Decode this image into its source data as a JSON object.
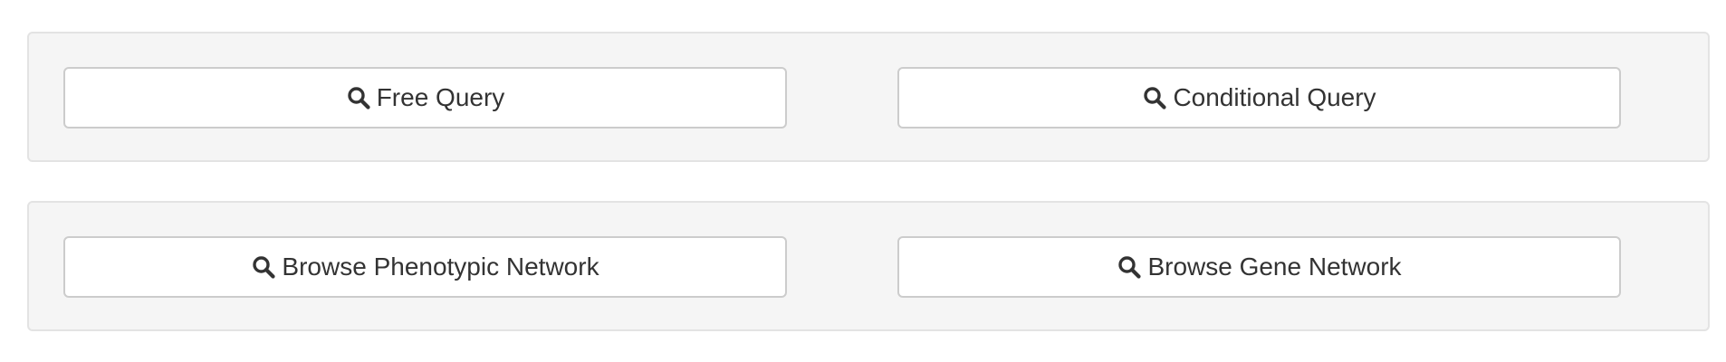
{
  "panels": [
    {
      "buttons": [
        {
          "label": "Free Query",
          "icon": "search-icon"
        },
        {
          "label": "Conditional Query",
          "icon": "search-icon"
        }
      ]
    },
    {
      "buttons": [
        {
          "label": "Browse Phenotypic Network",
          "icon": "search-icon"
        },
        {
          "label": "Browse Gene Network",
          "icon": "search-icon"
        }
      ]
    }
  ],
  "colors": {
    "panel_background": "#f5f5f5",
    "panel_border": "#e3e3e3",
    "button_background": "#ffffff",
    "button_border": "#cccccc",
    "text": "#333333"
  }
}
